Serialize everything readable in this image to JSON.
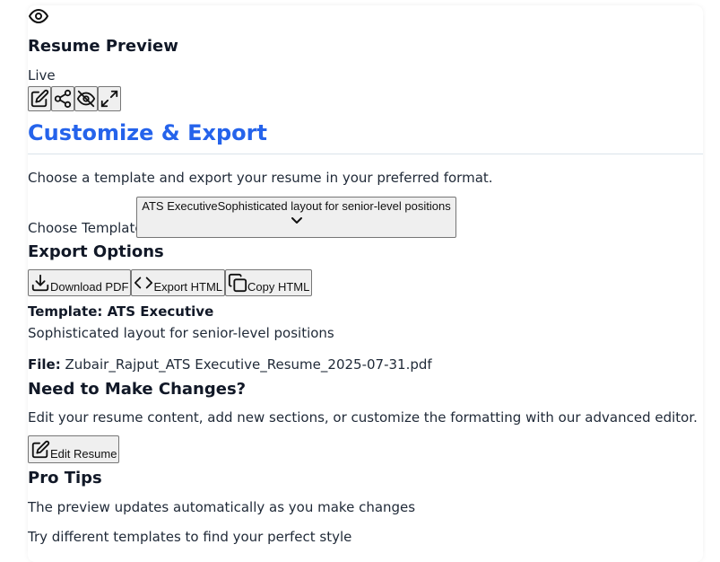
{
  "preview": {
    "eye_icon": "eye-icon",
    "title": "Resume Preview",
    "status": "Live",
    "toolbar_icons": [
      "edit-icon",
      "share-icon",
      "eye-off-icon",
      "expand-icon"
    ]
  },
  "customize": {
    "title": "Customize & Export",
    "description": "Choose a template and export your resume in your preferred format.",
    "template_label": "Choose Template",
    "selected_template_name": "ATS Executive",
    "selected_template_desc": "Sophisticated layout for senior-level positions",
    "accent_color": "#2563eb"
  },
  "export": {
    "heading": "Export Options",
    "download_pdf": "Download PDF",
    "export_html": "Export HTML",
    "copy_html": "Copy HTML"
  },
  "summary": {
    "template_label": "Template: ATS Executive",
    "template_desc": "Sophisticated layout for senior-level positions",
    "file_label": "File:",
    "file_name": "Zubair_Rajput_ATS Executive_Resume_2025-07-31.pdf"
  },
  "changes": {
    "heading": "Need to Make Changes?",
    "description": "Edit your resume content, add new sections, or customize the formatting with our advanced editor.",
    "edit_button": "Edit Resume"
  },
  "tips": {
    "heading": "Pro Tips",
    "items": [
      "The preview updates automatically as you make changes",
      "Try different templates to find your perfect style"
    ]
  }
}
